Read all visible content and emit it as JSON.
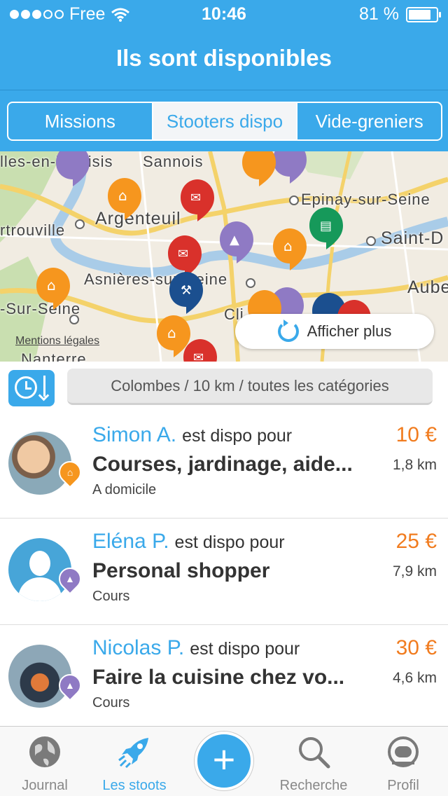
{
  "status_bar": {
    "carrier": "Free",
    "time": "10:46",
    "battery": "81 %",
    "battery_level": 0.81
  },
  "nav": {
    "title": "Ils sont disponibles"
  },
  "segments": [
    {
      "label": "Missions",
      "active": false
    },
    {
      "label": "Stooters dispo",
      "active": true
    },
    {
      "label": "Vide-greniers",
      "active": false
    }
  ],
  "map": {
    "places": [
      "lles-en-Yvelisis",
      "Sannois",
      "Argenteuil",
      "Epinay-sur-Seine",
      "rtrouville",
      "Saint-D",
      "Asnières-sur-Seine",
      "Aube",
      "-Sur-Seine",
      "Cli",
      "Nanterre"
    ],
    "mentions": "Mentions légales",
    "afficher_plus": "Afficher plus"
  },
  "filter": {
    "text": "Colombes / 10 km / toutes les catégories"
  },
  "list": [
    {
      "name": "Simon A.",
      "dispo": "est dispo pour",
      "service": "Courses, jardinage, aide...",
      "place": "A domicile",
      "price": "10 €",
      "distance": "1,8 km",
      "category_icon": "house-icon",
      "category_color": "#f6961e"
    },
    {
      "name": "Eléna P.",
      "dispo": "est dispo pour",
      "service": "Personal shopper",
      "place": "Cours",
      "price": "25 €",
      "distance": "7,9 km",
      "category_icon": "graduation-cap-icon",
      "category_color": "#8f7ac4"
    },
    {
      "name": "Nicolas P.",
      "dispo": "est dispo pour",
      "service": "Faire la cuisine chez vo...",
      "place": "Cours",
      "price": "30 €",
      "distance": "4,6 km",
      "category_icon": "graduation-cap-icon",
      "category_color": "#8f7ac4"
    }
  ],
  "tabbar": {
    "journal": "Journal",
    "les_stoots": "Les stoots",
    "recherche": "Recherche",
    "profil": "Profil",
    "add": "+"
  },
  "colors": {
    "accent": "#3aa9ea",
    "price": "#f17c1f",
    "house": "#f6961e",
    "course": "#8f7ac4",
    "message": "#d9312b",
    "market": "#16995a",
    "tools": "#1b4f8f"
  }
}
